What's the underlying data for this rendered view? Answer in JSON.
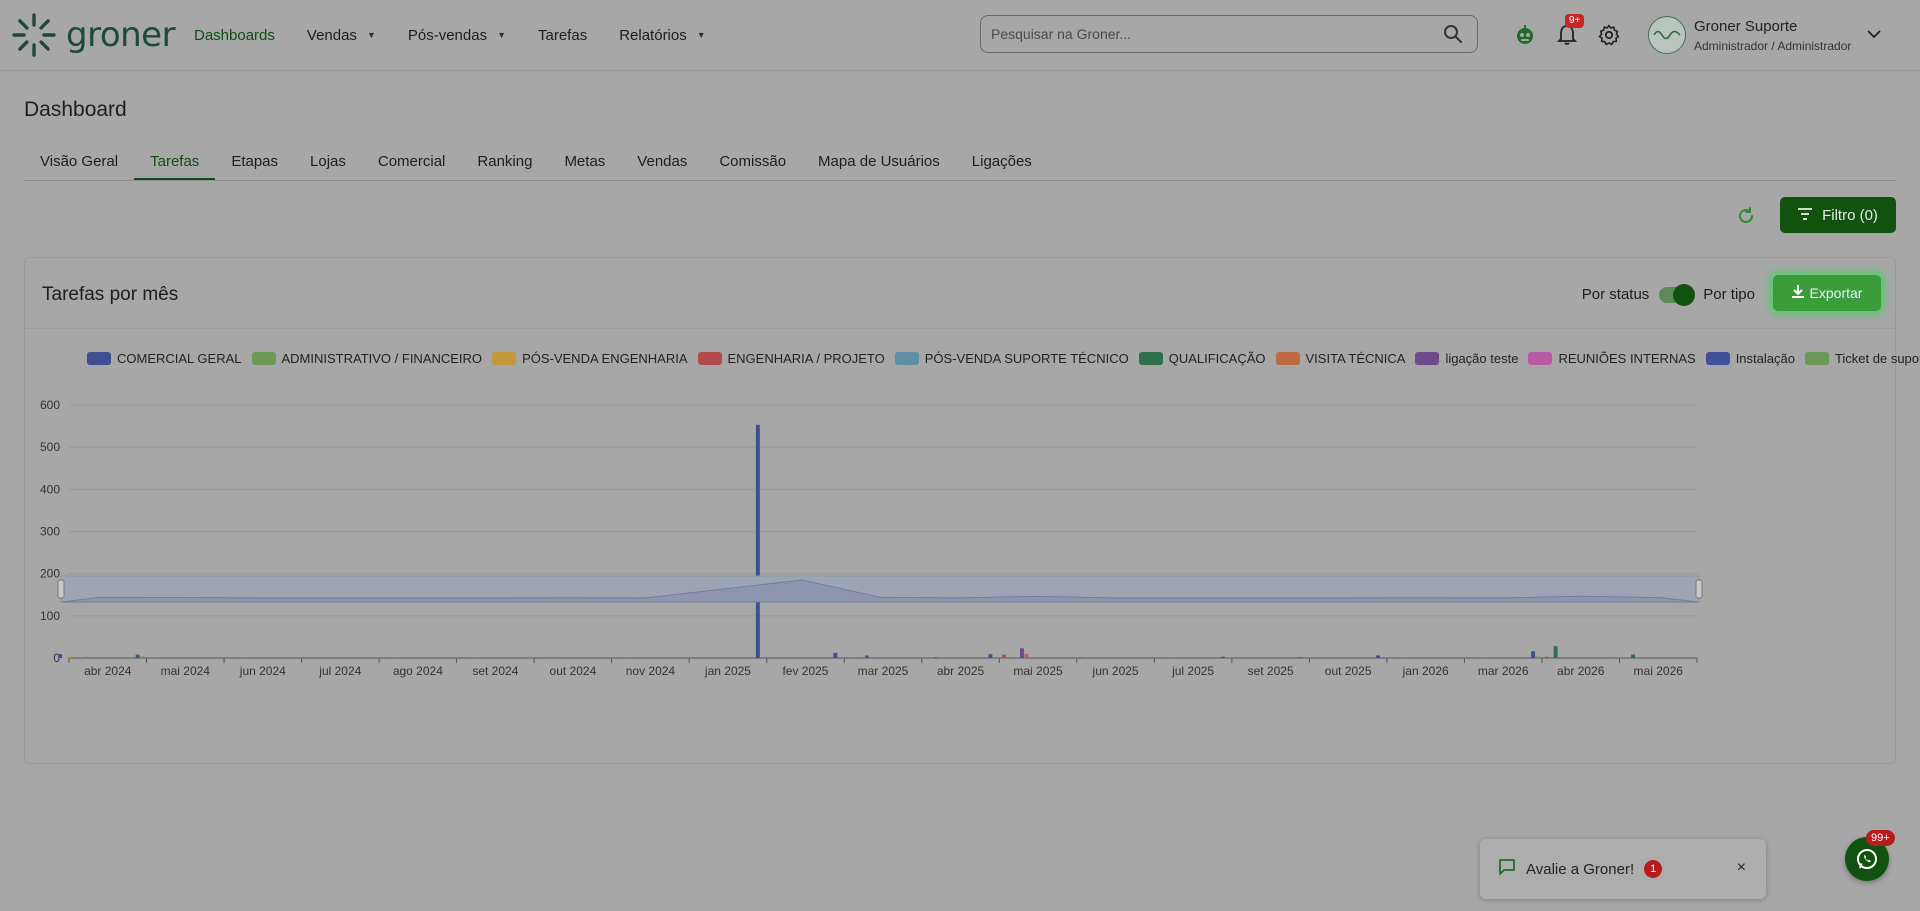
{
  "brand": {
    "name": "groner",
    "color": "#1d4a36"
  },
  "nav": [
    {
      "label": "Dashboards",
      "caret": false
    },
    {
      "label": "Vendas",
      "caret": true
    },
    {
      "label": "Pós-vendas",
      "caret": true
    },
    {
      "label": "Tarefas",
      "caret": false
    },
    {
      "label": "Relatórios",
      "caret": true
    }
  ],
  "search": {
    "placeholder": "Pesquisar na Groner..."
  },
  "header": {
    "notifications_badge": "9+"
  },
  "user": {
    "name": "Groner Suporte",
    "role": "Administrador / Administrador"
  },
  "page": {
    "title": "Dashboard"
  },
  "tabs": [
    "Visão Geral",
    "Tarefas",
    "Etapas",
    "Lojas",
    "Comercial",
    "Ranking",
    "Metas",
    "Vendas",
    "Comissão",
    "Mapa de Usuários",
    "Ligações"
  ],
  "active_tab": "Tarefas",
  "toolbar": {
    "filter_label": "Filtro (0)"
  },
  "card": {
    "title": "Tarefas por mês",
    "toggle_left": "Por status",
    "toggle_right": "Por tipo",
    "toggle_on": true,
    "export_label": "Exportar"
  },
  "chart_data": {
    "type": "bar",
    "ylim": [
      0,
      600
    ],
    "yticks": [
      0,
      100,
      200,
      300,
      400,
      500,
      600
    ],
    "grid": true,
    "legend_position": "top",
    "series": [
      {
        "name": "COMERCIAL GERAL",
        "color": "#3f4f8f"
      },
      {
        "name": "ADMINISTRATIVO / FINANCEIRO",
        "color": "#6a9a56"
      },
      {
        "name": "PÓS-VENDA ENGENHARIA",
        "color": "#c29a3c"
      },
      {
        "name": "ENGENHARIA / PROJETO",
        "color": "#b34a4a"
      },
      {
        "name": "PÓS-VENDA SUPORTE TÉCNICO",
        "color": "#5d8fa6"
      },
      {
        "name": "QUALIFICAÇÃO",
        "color": "#2f6e4f"
      },
      {
        "name": "VISITA TÉCNICA",
        "color": "#c06a42"
      },
      {
        "name": "ligação teste",
        "color": "#6f4a8a"
      },
      {
        "name": "REUNIÕES INTERNAS",
        "color": "#b85aa4"
      },
      {
        "name": "Instalação",
        "color": "#41509a"
      },
      {
        "name": "Ticket de suporte",
        "color": "#6a9a56"
      }
    ],
    "x_labels": [
      "abr 2024",
      "mai 2024",
      "jun 2024",
      "jul 2024",
      "ago 2024",
      "set 2024",
      "out 2024",
      "nov 2024",
      "jan 2025",
      "fev 2025",
      "mar 2025",
      "abr 2025",
      "mai 2025",
      "jun 2025",
      "jul 2025",
      "set 2025",
      "out 2025",
      "jan 2026",
      "mar 2026",
      "abr 2026",
      "mai 2026"
    ],
    "n_slots": 21,
    "bars": [
      {
        "slot": 0,
        "series": 0,
        "value": 9
      },
      {
        "slot": 0,
        "series": 2,
        "value": 6
      },
      {
        "slot": 0,
        "series": 6,
        "value": 3
      },
      {
        "slot": 1,
        "series": 0,
        "value": 8
      },
      {
        "slot": 1,
        "series": 1,
        "value": 4
      },
      {
        "slot": 1,
        "series": 4,
        "value": 2
      },
      {
        "slot": 2,
        "series": 6,
        "value": 2
      },
      {
        "slot": 3,
        "series": 3,
        "value": 2
      },
      {
        "slot": 4,
        "series": 6,
        "value": 2
      },
      {
        "slot": 5,
        "series": 6,
        "value": 2
      },
      {
        "slot": 6,
        "series": 1,
        "value": 3
      },
      {
        "slot": 6,
        "series": 6,
        "value": 3
      },
      {
        "slot": 7,
        "series": 6,
        "value": 2
      },
      {
        "slot": 9,
        "series": 0,
        "value": 553
      },
      {
        "slot": 10,
        "series": 0,
        "value": 12
      },
      {
        "slot": 10,
        "series": 7,
        "value": 6
      },
      {
        "slot": 10,
        "series": 4,
        "value": 2
      },
      {
        "slot": 11,
        "series": 5,
        "value": 2
      },
      {
        "slot": 12,
        "series": 0,
        "value": 9
      },
      {
        "slot": 12,
        "series": 3,
        "value": 8
      },
      {
        "slot": 12,
        "series": 7,
        "value": 23
      },
      {
        "slot": 12,
        "series": 8,
        "value": 10
      },
      {
        "slot": 13,
        "series": 3,
        "value": 2
      },
      {
        "slot": 14,
        "series": 6,
        "value": 2
      },
      {
        "slot": 15,
        "series": 0,
        "value": 3
      },
      {
        "slot": 16,
        "series": 0,
        "value": 2
      },
      {
        "slot": 17,
        "series": 0,
        "value": 6
      },
      {
        "slot": 17,
        "series": 6,
        "value": 2
      },
      {
        "slot": 18,
        "series": 6,
        "value": 2
      },
      {
        "slot": 19,
        "series": 0,
        "value": 16
      },
      {
        "slot": 19,
        "series": 3,
        "value": 3
      },
      {
        "slot": 19,
        "series": 5,
        "value": 28
      },
      {
        "slot": 19,
        "series": 1,
        "value": 4
      },
      {
        "slot": 20,
        "series": 5,
        "value": 8
      },
      {
        "slot": 20,
        "series": 1,
        "value": 3
      }
    ]
  },
  "toast": {
    "text": "Avalie a Groner!",
    "badge": "1",
    "close": "×"
  },
  "whatsapp": {
    "badge": "99+"
  }
}
